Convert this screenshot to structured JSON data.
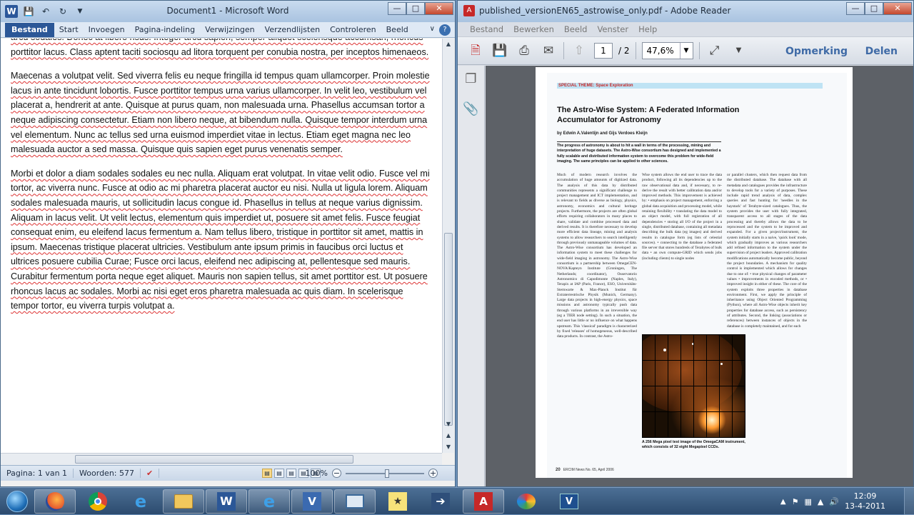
{
  "word": {
    "title": "Document1  -  Microsoft Word",
    "tabs": [
      "Bestand",
      "Start",
      "Invoegen",
      "Pagina-indeling",
      "Verwijzingen",
      "Verzendlijsten",
      "Controleren",
      "Beeld"
    ],
    "paragraphs": [
      "arcu sodales. Donec at libero risus. Integer arcu sapien, semper aliquet scelerisque accumsan, rhoncus porttitor lacus. Class aptent taciti sociosqu ad litora torquent per conubia nostra, per inceptos himenaeos.",
      "Maecenas a volutpat velit. Sed viverra felis eu neque fringilla id tempus quam ullamcorper. Proin molestie lacus in ante tincidunt lobortis. Fusce porttitor tempus urna varius ullamcorper. In velit leo, vestibulum vel placerat a, hendrerit at ante. Quisque at purus quam, non malesuada urna. Phasellus accumsan tortor a neque adipiscing consectetur. Etiam non libero neque, at bibendum nulla. Quisque tempor interdum urna vel elementum. Nunc ac tellus sed urna euismod imperdiet vitae in lectus. Etiam eget magna nec leo malesuada auctor a sed massa. Quisque quis sapien eget purus venenatis semper.",
      "Morbi et dolor a diam sodales sodales eu nec nulla. Aliquam erat volutpat. In vitae velit odio. Fusce vel mi tortor, ac viverra nunc. Fusce at odio ac mi pharetra placerat auctor eu nisi. Nulla ut ligula lorem. Aliquam sodales malesuada mauris, ut sollicitudin lacus congue id. Phasellus in tellus at neque varius dignissim. Aliquam in lacus velit. Ut velit lectus, elementum quis imperdiet ut, posuere sit amet felis. Fusce feugiat consequat enim, eu eleifend lacus fermentum a. Nam tellus libero, tristique in porttitor sit amet, mattis in ipsum. Maecenas tristique placerat ultricies. Vestibulum ante ipsum primis in faucibus orci luctus et ultrices posuere cubilia Curae; Fusce orci lacus, eleifend nec adipiscing at, pellentesque sed mauris. Curabitur fermentum porta neque eget aliquet. Mauris non sapien tellus, sit amet porttitor est. Ut posuere rhoncus lacus ac sodales. Morbi ac nisi eget eros pharetra malesuada ac quis diam. In scelerisque tempor tortor, eu viverra turpis volutpat a."
    ],
    "status": {
      "page": "Pagina: 1 van 1",
      "words": "Woorden: 577",
      "zoom": "100%"
    }
  },
  "reader": {
    "title": "published_versionEN65_astrowise_only.pdf - Adobe Reader",
    "menu": [
      "Bestand",
      "Bewerken",
      "Beeld",
      "Venster",
      "Help"
    ],
    "page_current": "1",
    "page_total": "/ 2",
    "zoom": "47,6%",
    "comment_label": "Opmerking",
    "share_label": "Delen",
    "pdf": {
      "theme": "SPECIAL THEME: Space Exploration",
      "title": "The Astro-Wise System: A Federated Information Accumulator for Astronomy",
      "authors": "by Edwin A.Valentijn and Gijs Verdoes Kleijn",
      "abstract": "The progress of astronomy is about to hit a wall in terms of the processing, mining and interpretation of huge datasets. The Astro-Wise consortium has designed and implemented a fully scalable and distributed information system to overcome this problem for wide-field imaging. The same principles can be applied to other sciences.",
      "col1": "Much of modern research involves the accumulation of huge amounts of digitized data. The analysis of this data by distributed communities represents a significant challenge to project management and ICT implementation, and is relevant to fields as diverse as biology, physics, astronomy, economics and cultural heritage projects. Furthermore, the projects are often global efforts requiring collaborators in many places to share, validate and combine processed data and derived results. It is therefore necessary to develop more efficient data lineage, mining and analysis systems to allow researchers to search intelligently through previously unmanageable volumes of data. The Astro-Wise consortium has developed an information system to meet these challenges for wide-field imaging in astronomy. The Astro-Wise consortium is a partnership between OmegaCEN-NOVA/Kapteyn Institute (Groningen, The Netherlands; coordinator), Osservatorio Astronomico di Capodimonte (Naples, Italy), Terapix at IAP (Paris, France), ESO, Universitäts-Sternwarte & Max-Planck Institut für Extraterrestrische Physik (Munich, Germany). Large data projects in high-energy physics, space missions and astronomy typically push data through various platforms in an irreversible way (eg a TIER node setting). In such a situation, the end user has little or no influence on what happens upstream. This 'classical' paradigm is characterized by fixed 'releases' of homogeneous, well-described data products. In contrast, the Astro-",
      "col2": "Wise system allows the end user to trace the data product, following all its dependencies up to the raw observational data and, if necessary, to re-derive the result with better calibration data and/or improved methods. This improvement is achieved by: • emphasis on project management, enforcing a global data acquisition and processing model, while retaining flexibility • translating the data model to an object model, with full registration of all dependencies • storing all I/O of the project in a single, distributed database, containing all metadata describing the bulk data (eg images) and derived results in catalogue form (eg lists of celestial sources). • connecting to the database a federated file server that stores hundreds of Terabytes of bulk data • an own compute-GRID which sends jobs (including clients) to single nodes",
      "col3": "or parallel clusters, which then request data from the distributed database. The database with all metadata and catalogues provides the infrastructure to develop tools for a variety of purposes. These include rapid trend analysis of data, complex queries and fast hunting for 'needles in the haystack' of Terabyte-sized catalogues. Thus, the system provides the user with fully integrated, transparent access to all stages of the data processing and thereby allows the data to be reprocessed and the system to be improved and expanded. For a given project/instrument, the system initially starts in a naive, 'quick look' mode, which gradually improves as various researchers add refined information to the system under the supervision of project leaders. Approved calibration modifications automatically become public, beyond the project boundaries. A mechanism for quality control is implemented which allows for changes due to one of: • true physical changes of parameter values • improvements in encoded methods, or • improved insight in either of these. The core of the system exploits three properties in database environment. First, we apply the principle of inheritance using Object Oriented Programming (Python), where all Astro-Wise objects inherit key properties for database access, such as persistency of attributes. Second, the linking (associations or references) between instances of objects in the database is completely maintained, and for each",
      "figure_caption": "A 256 Mega pixel test image of the OmegaCAM instrument, which consists of 32 eight Megapixel CCDs.",
      "footer_page": "20",
      "footer_text": "ERCIM News No. 65, April 2006"
    }
  },
  "taskbar": {
    "apps": [
      "firefox",
      "chrome",
      "ie",
      "explorer",
      "word",
      "ie-2",
      "visio",
      "remote",
      "notes",
      "vpn",
      "acrobat",
      "paint",
      "vbox"
    ],
    "time": "12:09",
    "date": "13-4-2011"
  }
}
